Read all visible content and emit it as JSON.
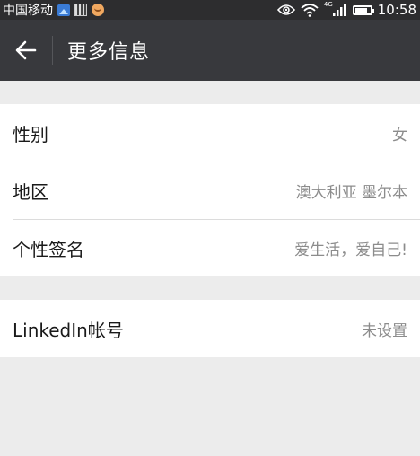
{
  "status_bar": {
    "carrier": "中国移动",
    "network_tag": "4G",
    "time": "10:58",
    "icons": [
      "gallery-icon",
      "qr-app-icon",
      "face-app-icon",
      "eye-icon",
      "wifi-icon",
      "signal-icon",
      "battery-icon"
    ],
    "battery_level": 0.85
  },
  "header": {
    "back_icon": "arrow-left-icon",
    "title": "更多信息"
  },
  "groups": [
    {
      "rows": [
        {
          "label": "性别",
          "value": "女"
        },
        {
          "label": "地区",
          "value": "澳大利亚 墨尔本"
        },
        {
          "label": "个性签名",
          "value": "爱生活，爱自己!"
        }
      ]
    },
    {
      "rows": [
        {
          "label": "LinkedIn帐号",
          "value": "未设置"
        }
      ]
    }
  ],
  "colors": {
    "status_bar_bg": "#2d2d2f",
    "title_bar_bg": "#38393d",
    "page_bg": "#ececec",
    "row_bg": "#ffffff",
    "value_text": "#8c8c8c"
  }
}
